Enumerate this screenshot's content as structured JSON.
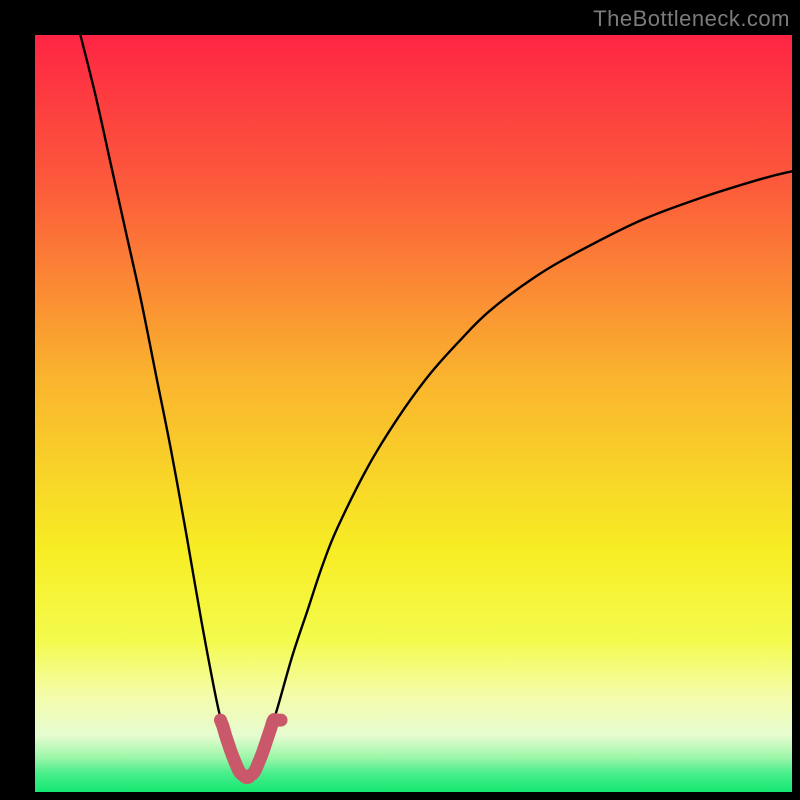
{
  "watermark": "TheBottleneck.com",
  "colors": {
    "background": "#000000",
    "curve": "#000000",
    "marker": "#C9596A",
    "gradient_stops": [
      {
        "offset": 0.0,
        "color": "#FE2544"
      },
      {
        "offset": 0.2,
        "color": "#FC5B3B"
      },
      {
        "offset": 0.45,
        "color": "#FAB32E"
      },
      {
        "offset": 0.68,
        "color": "#F7ED24"
      },
      {
        "offset": 0.8,
        "color": "#F4FB4D"
      },
      {
        "offset": 0.87,
        "color": "#F5FCA8"
      },
      {
        "offset": 0.925,
        "color": "#E6FCD0"
      },
      {
        "offset": 0.955,
        "color": "#9BF6A8"
      },
      {
        "offset": 0.975,
        "color": "#4AEE8C"
      },
      {
        "offset": 1.0,
        "color": "#14E872"
      }
    ]
  },
  "chart_data": {
    "type": "line",
    "title": "",
    "xlabel": "",
    "ylabel": "",
    "xlim": [
      0,
      100
    ],
    "ylim": [
      0,
      100
    ],
    "x_optimum": 28,
    "marker_x_range": [
      24.5,
      32.5
    ],
    "marker_y_max": 9.5,
    "series": [
      {
        "name": "bottleneck-curve",
        "x": [
          6,
          8,
          10,
          12,
          14,
          16,
          18,
          20,
          22,
          24,
          25,
          26,
          27,
          28,
          29,
          30,
          31,
          32,
          34,
          36,
          38,
          40,
          44,
          48,
          52,
          56,
          60,
          66,
          72,
          80,
          88,
          96,
          100
        ],
        "y": [
          100,
          92,
          83,
          74,
          65,
          55,
          45,
          34,
          22.5,
          12,
          8,
          5,
          2.6,
          1.8,
          2.6,
          5,
          8,
          11,
          18,
          24,
          30,
          35,
          43,
          49.5,
          55,
          59.5,
          63.5,
          68,
          71.5,
          75.5,
          78.5,
          81,
          82
        ]
      }
    ]
  }
}
